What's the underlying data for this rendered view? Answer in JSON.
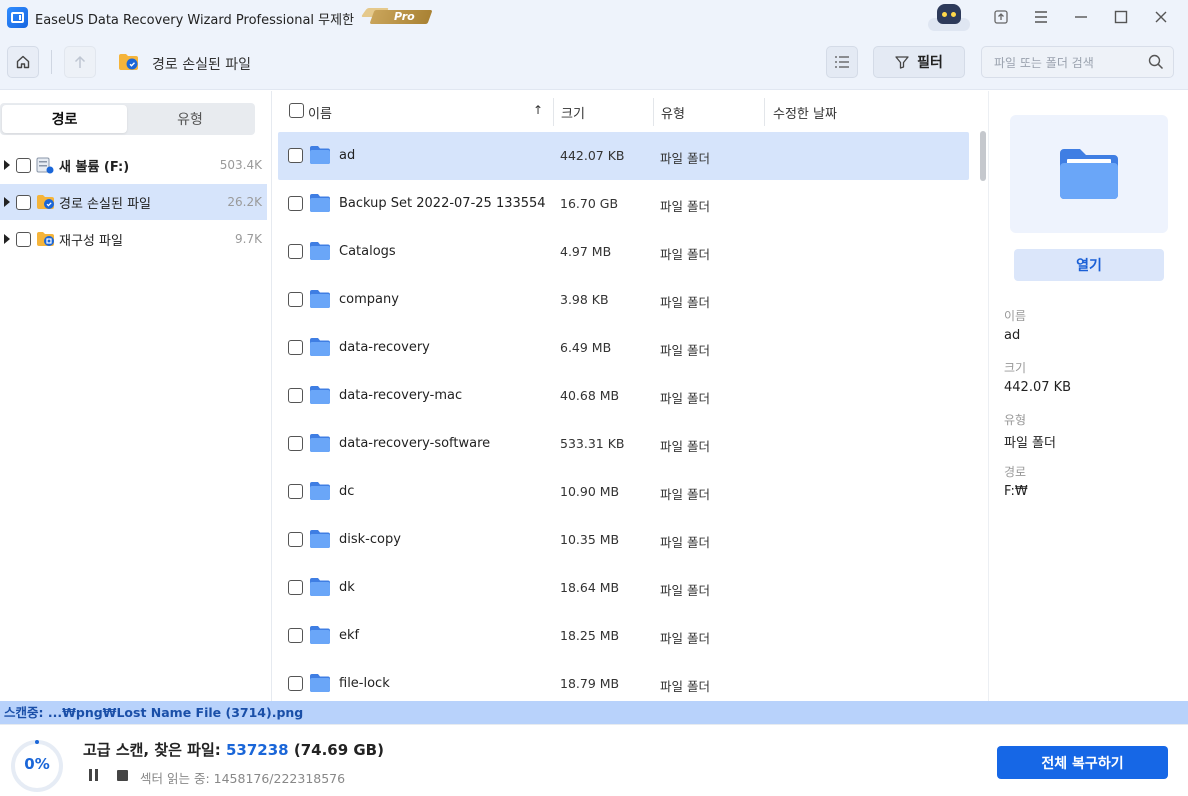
{
  "window": {
    "title": "EaseUS Data Recovery Wizard Professional 무제한",
    "badge": "Pro"
  },
  "toolbar": {
    "breadcrumb": "경로 손실된 파일",
    "filter_label": "필터",
    "search_placeholder": "파일 또는 폴더 검색"
  },
  "sidebar": {
    "tabs": [
      {
        "label": "경로",
        "active": true
      },
      {
        "label": "유형",
        "active": false
      }
    ],
    "items": [
      {
        "label": "새 볼륨 (F:)",
        "count": "503.4K",
        "icon": "drive-icon",
        "bold": true,
        "selected": false
      },
      {
        "label": "경로 손실된 파일",
        "count": "26.2K",
        "icon": "lost-folder-icon",
        "bold": false,
        "selected": true
      },
      {
        "label": "재구성 파일",
        "count": "9.7K",
        "icon": "reconstructed-folder-icon",
        "bold": false,
        "selected": false
      }
    ]
  },
  "file_list": {
    "columns": {
      "name": "이름",
      "size": "크기",
      "type": "유형",
      "modified": "수정한 날짜"
    },
    "sort_arrow": "↑",
    "rows": [
      {
        "name": "ad",
        "size": "442.07 KB",
        "type": "파일 폴더",
        "selected": true
      },
      {
        "name": "Backup Set 2022-07-25 133554",
        "size": "16.70 GB",
        "type": "파일 폴더",
        "selected": false
      },
      {
        "name": "Catalogs",
        "size": "4.97 MB",
        "type": "파일 폴더",
        "selected": false
      },
      {
        "name": "company",
        "size": "3.98 KB",
        "type": "파일 폴더",
        "selected": false
      },
      {
        "name": "data-recovery",
        "size": "6.49 MB",
        "type": "파일 폴더",
        "selected": false
      },
      {
        "name": "data-recovery-mac",
        "size": "40.68 MB",
        "type": "파일 폴더",
        "selected": false
      },
      {
        "name": "data-recovery-software",
        "size": "533.31 KB",
        "type": "파일 폴더",
        "selected": false
      },
      {
        "name": "dc",
        "size": "10.90 MB",
        "type": "파일 폴더",
        "selected": false
      },
      {
        "name": "disk-copy",
        "size": "10.35 MB",
        "type": "파일 폴더",
        "selected": false
      },
      {
        "name": "dk",
        "size": "18.64 MB",
        "type": "파일 폴더",
        "selected": false
      },
      {
        "name": "ekf",
        "size": "18.25 MB",
        "type": "파일 폴더",
        "selected": false
      },
      {
        "name": "file-lock",
        "size": "18.79 MB",
        "type": "파일 폴더",
        "selected": false
      }
    ]
  },
  "preview": {
    "open_label": "열기",
    "fields": [
      {
        "label": "이름",
        "value": "ad"
      },
      {
        "label": "크기",
        "value": "442.07 KB"
      },
      {
        "label": "유형",
        "value": "파일 폴더"
      },
      {
        "label": "경로",
        "value": "F:₩"
      }
    ]
  },
  "status": {
    "scanning_text": "스캔중: ...₩png₩Lost Name File (3714).png",
    "progress_percent": "0%",
    "progress_fraction": 0.0,
    "scan_label": "고급 스캔, 찾은 파일: ",
    "found_count": "537238",
    "found_size": " (74.69 GB)",
    "sector_text": "섹터 읽는 중: 1458176/222318576",
    "recover_all_label": "전체 복구하기"
  },
  "colors": {
    "accent": "#1667e6",
    "selection": "#d6e4fb",
    "folder": "#5b9cf2",
    "status_strip": "#b8d2fb"
  }
}
